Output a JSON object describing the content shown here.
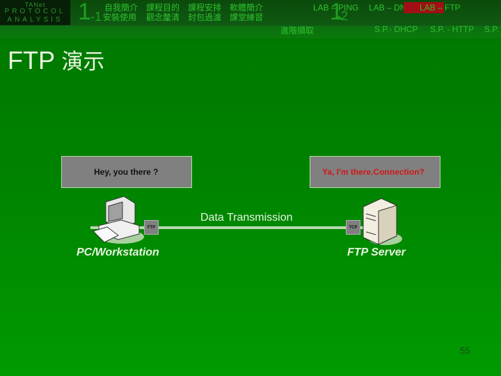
{
  "header": {
    "logo": {
      "line1": "TANet",
      "line2": "PROTOCOL",
      "line3": "ANALYSIS"
    },
    "section1": {
      "big": "1",
      "small": "-1"
    },
    "section2": {
      "big": "1",
      "small": "-2"
    },
    "nav_row1": [
      "自我簡介",
      "課程目的",
      "課程安排",
      "軟體簡介"
    ],
    "nav_row2": [
      "安裝使用",
      "觀念釐清",
      "封包過濾",
      "課堂練習"
    ],
    "labs": [
      "LAB – PING",
      "LAB – DNS",
      "LAB – FTP"
    ],
    "active_lab_index": 2,
    "sub": {
      "advanced": "進階擷取",
      "sp1": "S.P.- DHCP",
      "sp2": "S.P. - HTTP",
      "sp3": "S.P."
    }
  },
  "slide": {
    "title_latin": "FTP",
    "title_cjk": "演示",
    "client_message": "Hey, you there ?",
    "server_message": "Ya, I'm there.Connection?",
    "data_transmission": "Data Transmission",
    "client_tag": "FTP",
    "server_tag": "TCP",
    "client_label": "PC/Workstation",
    "server_label": "FTP Server",
    "page_number": "55"
  },
  "colors": {
    "client_text": "#111111",
    "server_text": "#d01818",
    "active_lab_bg": "#a10f14"
  }
}
